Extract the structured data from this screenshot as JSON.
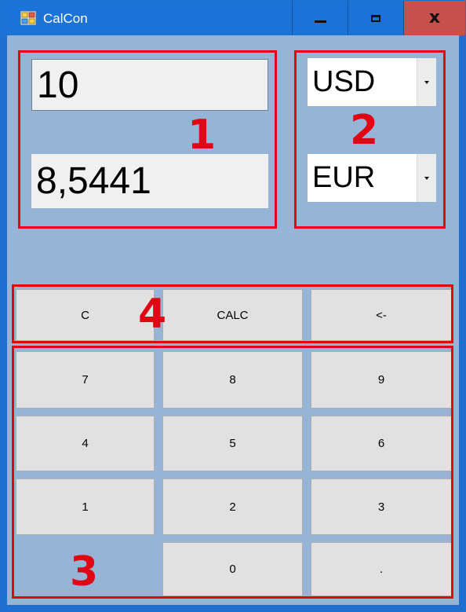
{
  "window": {
    "title": "CalCon",
    "close_glyph": "x"
  },
  "inputs": {
    "amount_value": "10",
    "result_value": "8,5441"
  },
  "currencies": {
    "from": "USD",
    "to": "EUR"
  },
  "buttons": {
    "clear": "C",
    "calc": "CALC",
    "backspace": "<-",
    "digits": [
      "7",
      "8",
      "9",
      "4",
      "5",
      "6",
      "1",
      "2",
      "3",
      "0",
      "."
    ]
  },
  "annotations": [
    "1",
    "2",
    "3",
    "4"
  ],
  "colors": {
    "titlebar": "#1b73d8",
    "client_bg": "#96b4d6",
    "annotation": "#e10613",
    "close_button": "#c7504d"
  }
}
